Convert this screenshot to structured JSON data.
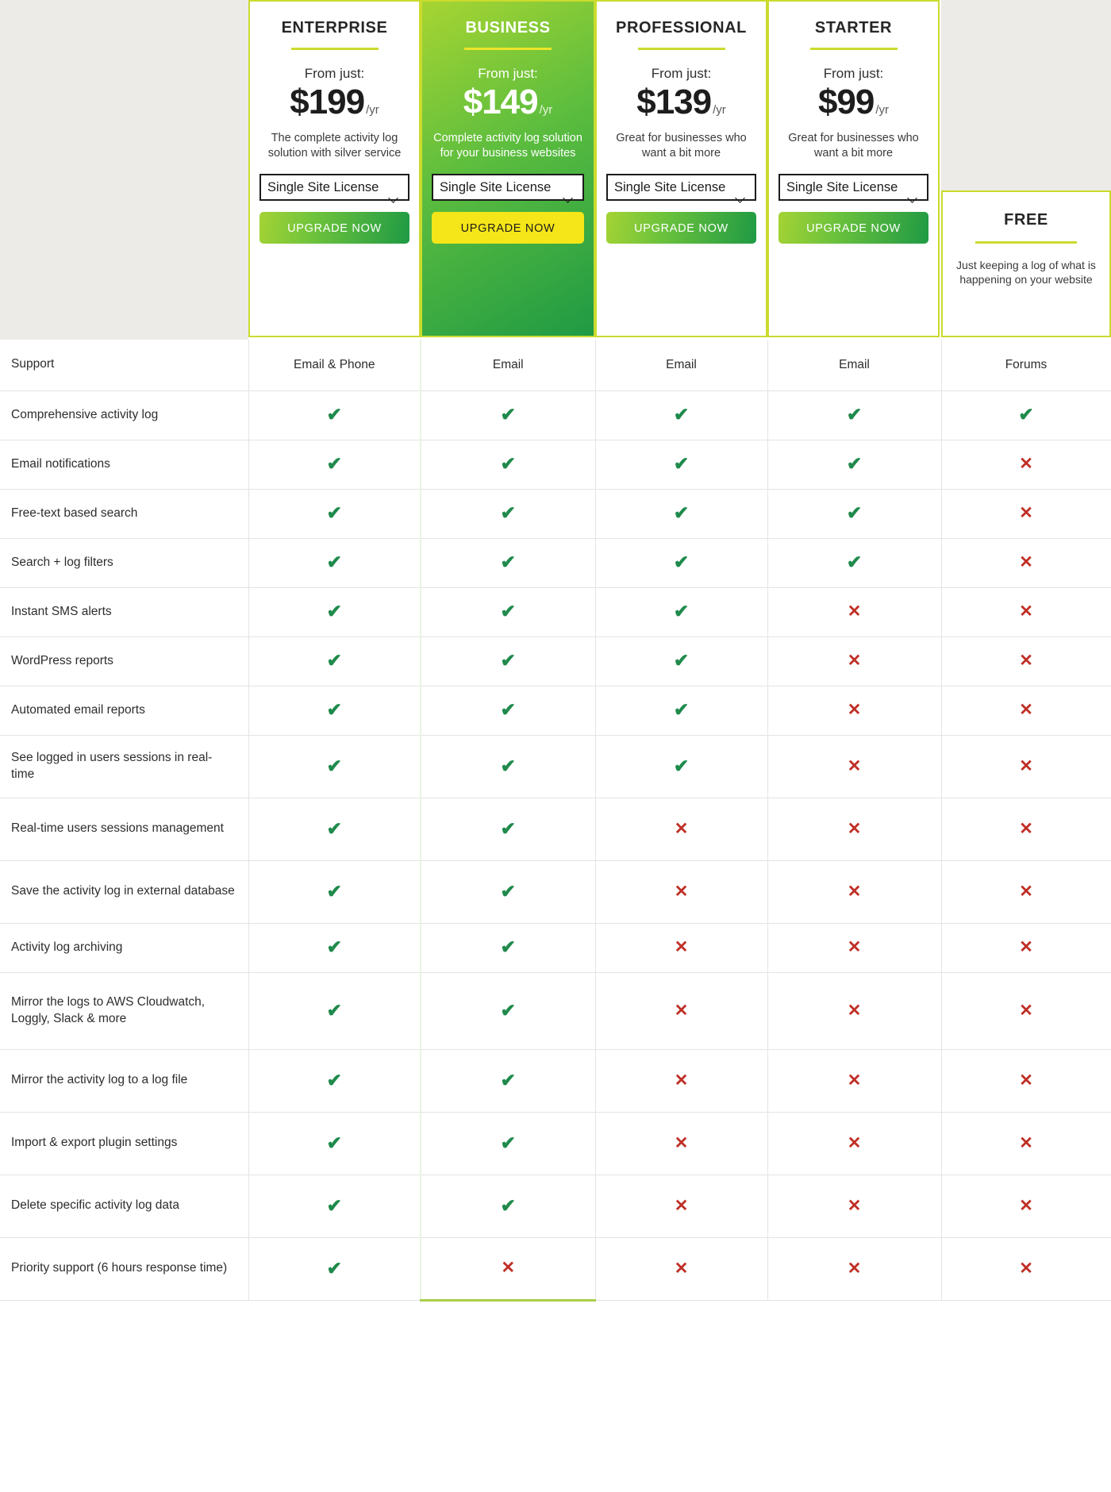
{
  "colors": {
    "card_border": "#cbdb2e",
    "accent_rule": "#cbdb2e",
    "business_gradient_start": "#a7d532",
    "business_gradient_end": "#1f9a44",
    "upgrade_button_gradient_start": "#a4d334",
    "upgrade_button_gradient_end": "#1f9a44",
    "business_button_bg": "#f5e619",
    "check_green": "#1f8a4c",
    "cross_red": "#bf2f26",
    "panel_grey": "#ecebe8"
  },
  "plans": [
    {
      "id": "enterprise",
      "name": "ENTERPRISE",
      "from_label": "From just:",
      "price": "$199",
      "period": "/yr",
      "description": "The complete activity log solution with silver service",
      "license_selected": "Single Site License",
      "license_options": [
        "Single Site License"
      ],
      "cta_label": "UPGRADE NOW",
      "highlighted": false
    },
    {
      "id": "business",
      "name": "BUSINESS",
      "from_label": "From just:",
      "price": "$149",
      "period": "/yr",
      "description": "Complete activity log solution for your business websites",
      "license_selected": "Single Site License",
      "license_options": [
        "Single Site License"
      ],
      "cta_label": "UPGRADE NOW",
      "highlighted": true
    },
    {
      "id": "professional",
      "name": "PROFESSIONAL",
      "from_label": "From just:",
      "price": "$139",
      "period": "/yr",
      "description": "Great for businesses who want a bit more",
      "license_selected": "Single Site License",
      "license_options": [
        "Single Site License"
      ],
      "cta_label": "UPGRADE NOW",
      "highlighted": false
    },
    {
      "id": "starter",
      "name": "STARTER",
      "from_label": "From just:",
      "price": "$99",
      "period": "/yr",
      "description": "Great for businesses who want a bit more",
      "license_selected": "Single Site License",
      "license_options": [
        "Single Site License"
      ],
      "cta_label": "UPGRADE NOW",
      "highlighted": false
    },
    {
      "id": "free",
      "name": "FREE",
      "description": "Just keeping a log of what is happening on your website",
      "highlighted": false
    }
  ],
  "table": {
    "rows": [
      {
        "feature": "Support",
        "lines": 1,
        "values": [
          "Email & Phone",
          "Email",
          "Email",
          "Email",
          "Forums"
        ],
        "type": "text"
      },
      {
        "feature": "Comprehensive activity log",
        "lines": 1,
        "values": [
          "yes",
          "yes",
          "yes",
          "yes",
          "yes"
        ],
        "type": "icon"
      },
      {
        "feature": "Email notifications",
        "lines": 1,
        "values": [
          "yes",
          "yes",
          "yes",
          "yes",
          "no"
        ],
        "type": "icon"
      },
      {
        "feature": "Free-text based search",
        "lines": 1,
        "values": [
          "yes",
          "yes",
          "yes",
          "yes",
          "no"
        ],
        "type": "icon"
      },
      {
        "feature": "Search + log filters",
        "lines": 1,
        "values": [
          "yes",
          "yes",
          "yes",
          "yes",
          "no"
        ],
        "type": "icon"
      },
      {
        "feature": "Instant SMS alerts",
        "lines": 1,
        "values": [
          "yes",
          "yes",
          "yes",
          "no",
          "no"
        ],
        "type": "icon"
      },
      {
        "feature": "WordPress reports",
        "lines": 1,
        "values": [
          "yes",
          "yes",
          "yes",
          "no",
          "no"
        ],
        "type": "icon"
      },
      {
        "feature": "Automated email reports",
        "lines": 1,
        "values": [
          "yes",
          "yes",
          "yes",
          "no",
          "no"
        ],
        "type": "icon"
      },
      {
        "feature": "See logged in users sessions in real-time",
        "lines": 2,
        "values": [
          "yes",
          "yes",
          "yes",
          "no",
          "no"
        ],
        "type": "icon"
      },
      {
        "feature": "Real-time users sessions management",
        "lines": 2,
        "values": [
          "yes",
          "yes",
          "no",
          "no",
          "no"
        ],
        "type": "icon"
      },
      {
        "feature": "Save the activity log in external database",
        "lines": 2,
        "values": [
          "yes",
          "yes",
          "no",
          "no",
          "no"
        ],
        "type": "icon"
      },
      {
        "feature": "Activity log archiving",
        "lines": 1,
        "values": [
          "yes",
          "yes",
          "no",
          "no",
          "no"
        ],
        "type": "icon"
      },
      {
        "feature": "Mirror the logs to AWS Cloudwatch, Loggly, Slack & more",
        "lines": 3,
        "values": [
          "yes",
          "yes",
          "no",
          "no",
          "no"
        ],
        "type": "icon"
      },
      {
        "feature": "Mirror the activity log to a log file",
        "lines": 2,
        "values": [
          "yes",
          "yes",
          "no",
          "no",
          "no"
        ],
        "type": "icon"
      },
      {
        "feature": "Import & export plugin settings",
        "lines": 2,
        "values": [
          "yes",
          "yes",
          "no",
          "no",
          "no"
        ],
        "type": "icon"
      },
      {
        "feature": "Delete specific activity log data",
        "lines": 2,
        "values": [
          "yes",
          "yes",
          "no",
          "no",
          "no"
        ],
        "type": "icon"
      },
      {
        "feature": "Priority support (6 hours response time)",
        "lines": 2,
        "values": [
          "yes",
          "no",
          "no",
          "no",
          "no"
        ],
        "type": "icon"
      }
    ]
  },
  "icons": {
    "check": "✔",
    "cross": "✕",
    "chevron_down": "chevron-down-icon"
  }
}
